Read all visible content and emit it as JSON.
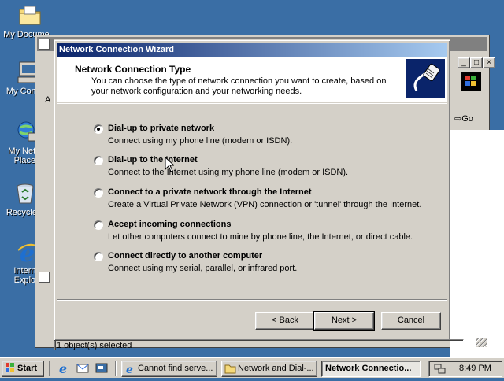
{
  "desktop": {
    "icons": [
      {
        "label": "My Docume...",
        "icon": "folder-icon"
      },
      {
        "label": "My Comp...",
        "icon": "computer-icon"
      },
      {
        "label": "My Netw...",
        "label2": "Place...",
        "icon": "network-places-icon"
      },
      {
        "label": "Recycle...",
        "icon": "recycle-bin-icon"
      },
      {
        "label": "Intern...",
        "label2": "Explo...",
        "icon": "internet-explorer-icon"
      }
    ]
  },
  "background_window": {
    "go_label": "Go",
    "status": "1 object(s) selected",
    "address_fragment": "A"
  },
  "wizard": {
    "title": "Network Connection Wizard",
    "header_title": "Network Connection Type",
    "header_subtitle": "You can choose the type of network connection you want to create, based on your network configuration and your networking needs.",
    "options": [
      {
        "label": "Dial-up to private network",
        "desc": "Connect using my phone line (modem or ISDN).",
        "checked": true
      },
      {
        "label": "Dial-up to the Internet",
        "desc": "Connect to the Internet using my phone line (modem or ISDN).",
        "checked": false
      },
      {
        "label": "Connect to a private network through the Internet",
        "desc": "Create a Virtual Private Network (VPN) connection or 'tunnel' through the Internet.",
        "checked": false
      },
      {
        "label": "Accept incoming connections",
        "desc": "Let other computers connect to mine by phone line, the Internet, or direct cable.",
        "checked": false
      },
      {
        "label": "Connect directly to another computer",
        "desc": "Connect using my serial, parallel, or infrared port.",
        "checked": false
      }
    ],
    "buttons": {
      "back": "< Back",
      "next": "Next >",
      "cancel": "Cancel"
    }
  },
  "taskbar": {
    "start_label": "Start",
    "tasks": [
      {
        "label": "Cannot find serve...",
        "active": false
      },
      {
        "label": "Network and Dial-...",
        "active": false
      },
      {
        "label": "Network Connectio...",
        "active": true
      }
    ],
    "clock": "8:49 PM"
  },
  "colors": {
    "desktop": "#3a6ea5",
    "title_active_start": "#0a246a",
    "title_active_end": "#a6caf0",
    "face": "#d4d0c8"
  }
}
